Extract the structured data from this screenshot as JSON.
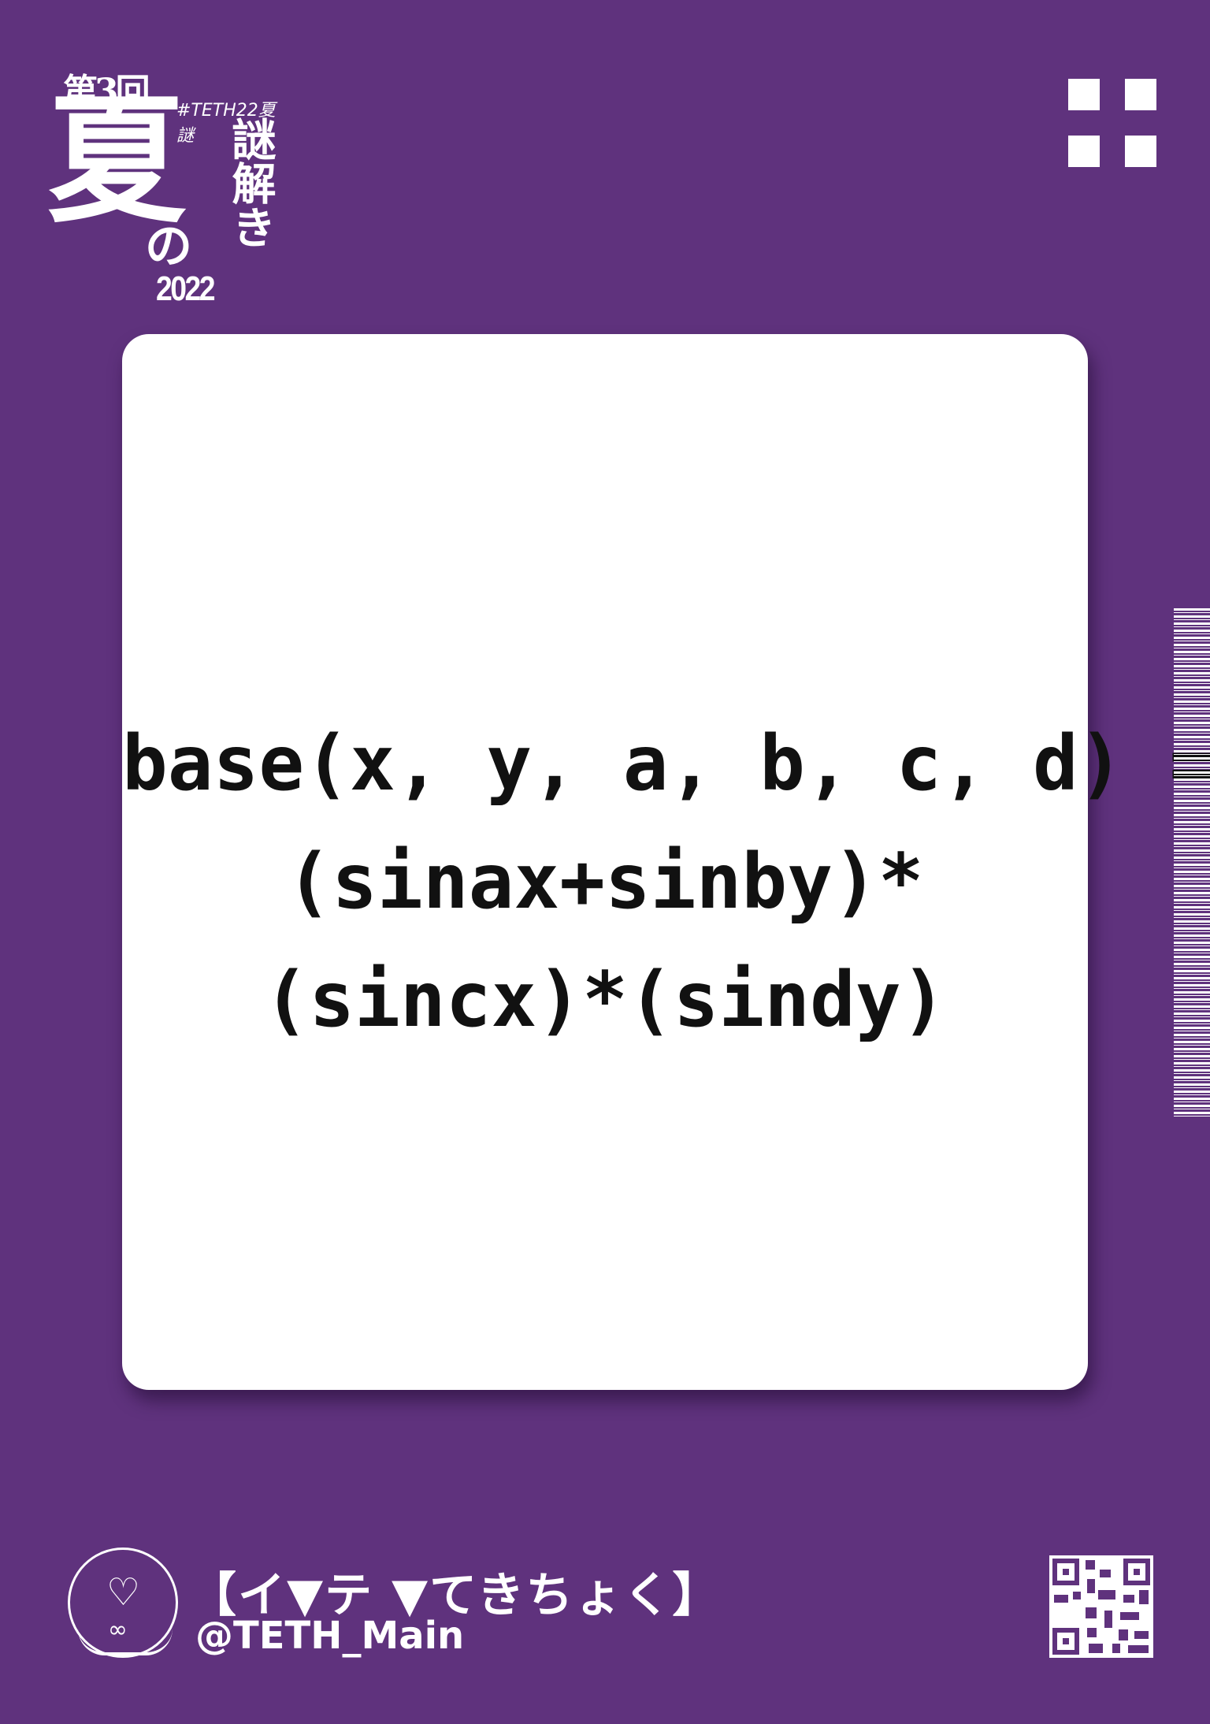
{
  "logo": {
    "edition": "第3回",
    "title_big": "夏",
    "title_no": "の",
    "year": "2022",
    "hashtag": "#TETH22夏謎",
    "title_vertical": "謎解き"
  },
  "card": {
    "formula_lines": [
      "base(x, y, a, b, c, d) =",
      "(sinax+sinby)*",
      "(sincx)*(sindy)"
    ]
  },
  "footer": {
    "account_name": "【イ▼テ ▼てきちょく】",
    "account_handle": "@TETH_Main"
  }
}
